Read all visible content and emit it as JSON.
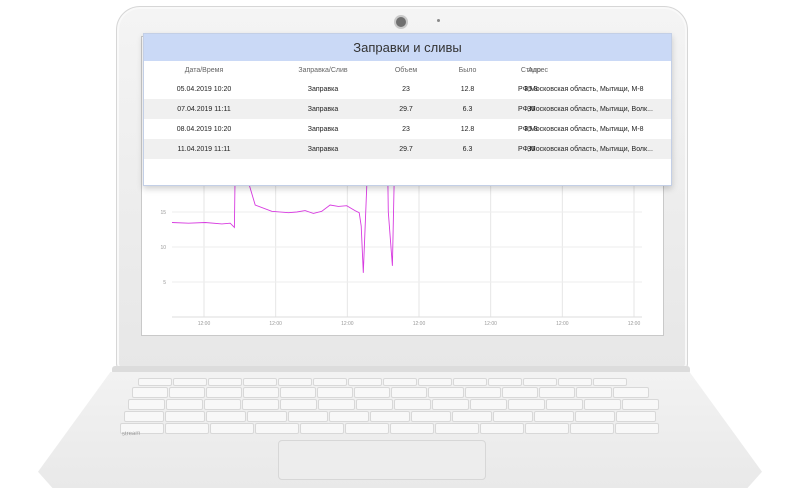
{
  "panel": {
    "title": "Заправки и сливы",
    "headers": [
      "Дата/Время",
      "Заправка/Слив",
      "Объем",
      "Было",
      "Стало",
      "Адрес"
    ],
    "rows": [
      [
        "05.04.2019 10:20",
        "Заправка",
        "23",
        "12.8",
        "35.8",
        "РФ,Московская область, Мытищи, М-8"
      ],
      [
        "07.04.2019 11:11",
        "Заправка",
        "29.7",
        "6.3",
        "36",
        "РФ,Московская область, Мытищи, Волк..."
      ],
      [
        "08.04.2019 10:20",
        "Заправка",
        "23",
        "12.8",
        "35.8",
        "РФ,Московская область, Мытищи, М-8"
      ],
      [
        "11.04.2019 11:11",
        "Заправка",
        "29.7",
        "6.3",
        "36",
        "РФ,Московская область, Мытищи, Волк..."
      ]
    ]
  },
  "laptop": {
    "brand": "stream"
  },
  "chart_data": {
    "type": "line",
    "title": "",
    "xlabel": "",
    "ylabel": "",
    "x_tick_labels": [
      "12:00",
      "12:00",
      "12:00",
      "12:00",
      "12:00",
      "12:00",
      "12:00"
    ],
    "y_tick_labels": [
      "5",
      "10",
      "15",
      "20",
      "25"
    ],
    "ylim": [
      0,
      40
    ],
    "series": [
      {
        "color": "#d73be0",
        "x": [
          0,
          0.4,
          0.8,
          1.2,
          1.4,
          1.5,
          1.55,
          1.6,
          1.75,
          1.8,
          2.0,
          2.4,
          2.8,
          3.0,
          3.2,
          3.4,
          3.6,
          3.8,
          4.0,
          4.2,
          4.4,
          4.5,
          4.55,
          4.6,
          4.8,
          5.0,
          5.15,
          5.2,
          5.3,
          5.4,
          6.0,
          6.1,
          6.15,
          6.2,
          6.3,
          6.6,
          6.7,
          6.8,
          7.0,
          7.3,
          7.5,
          7.6,
          7.7,
          7.8,
          8.0,
          8.6,
          8.7,
          8.85,
          9.0,
          9.2,
          9.4,
          9.7,
          9.9,
          10.1,
          10.3,
          10.6,
          10.8,
          11.0,
          11.2,
          11.3
        ],
        "y": [
          13.5,
          13.4,
          13.5,
          13.3,
          13.4,
          12.8,
          35.8,
          31,
          27,
          20,
          16,
          15.1,
          14.9,
          15.0,
          15.2,
          14.8,
          15.1,
          16.0,
          15.8,
          15.9,
          15.2,
          14.9,
          13.0,
          6.3,
          36.0,
          40,
          36,
          15,
          7.3,
          36.0,
          40,
          35.6,
          33.0,
          35.9,
          36.0,
          36.2,
          36.0,
          36.1,
          35.8,
          38,
          38.5,
          36.5,
          35.6,
          35.8,
          36.0,
          35.9,
          33.6,
          35.8,
          35.9,
          36.1,
          34.0,
          32.6,
          33.0,
          32.8,
          32.9,
          32.7,
          32.8,
          31.9,
          33.0,
          33.3
        ]
      }
    ]
  }
}
